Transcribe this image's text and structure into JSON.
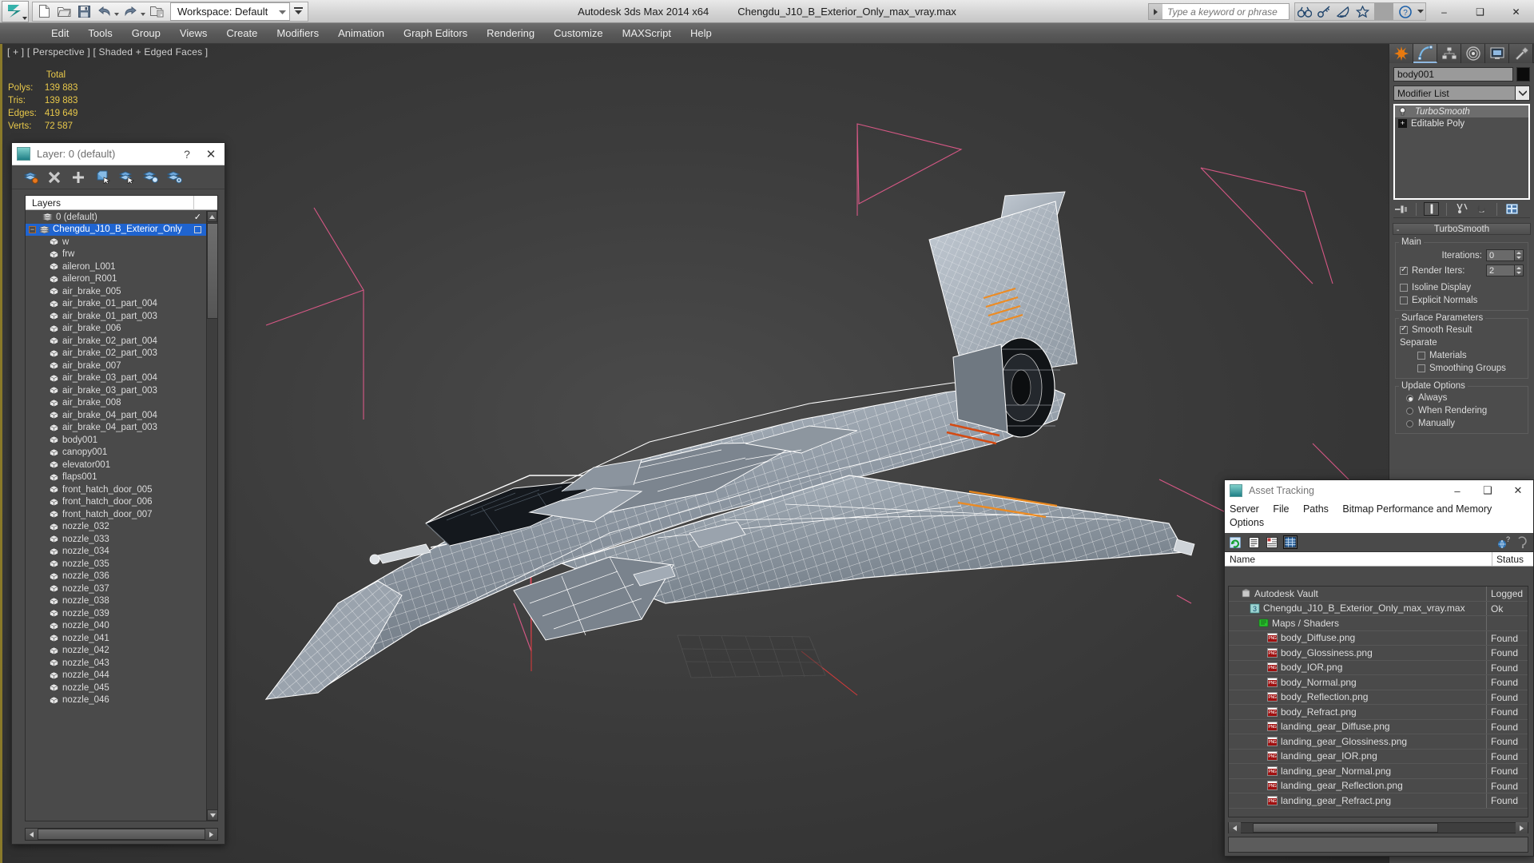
{
  "titlebar": {
    "app_title": "Autodesk 3ds Max  2014 x64",
    "file_title": "Chengdu_J10_B_Exterior_Only_max_vray.max",
    "workspace_label": "Workspace: Default",
    "search_placeholder": "Type a keyword or phrase",
    "quick_access": [
      "new-file-icon",
      "open-file-icon",
      "save-file-icon",
      "undo-icon",
      "redo-icon",
      "set-project-folder-icon"
    ],
    "infocenter_icons": [
      "binoculars-icon",
      "key-icon",
      "satellite-dish-icon",
      "star-icon",
      "help-icon"
    ],
    "window_buttons": {
      "minimize": "–",
      "maximize": "❑",
      "close": "✕"
    }
  },
  "menubar": {
    "items": [
      "Edit",
      "Tools",
      "Group",
      "Views",
      "Create",
      "Modifiers",
      "Animation",
      "Graph Editors",
      "Rendering",
      "Customize",
      "MAXScript",
      "Help"
    ]
  },
  "viewport": {
    "label": "[ + ] [ Perspective ] [ Shaded + Edged Faces ]",
    "stats": {
      "header": "Total",
      "rows": [
        {
          "label": "Polys:",
          "value": "139 883"
        },
        {
          "label": "Tris:",
          "value": "139 883"
        },
        {
          "label": "Edges:",
          "value": "419 649"
        },
        {
          "label": "Verts:",
          "value": "72 587"
        }
      ]
    },
    "colors": {
      "stats_text": "#e8c84a",
      "gizmo_pink": "#e05a8a",
      "background": "#3c3c3c"
    }
  },
  "layer_dialog": {
    "title": "Layer: 0 (default)",
    "help_glyph": "?",
    "close_glyph": "✕",
    "toolbar_icons": [
      "create-new-layer-icon",
      "delete-layer-icon",
      "add-selection-to-layer-icon",
      "select-objects-in-layer-icon",
      "select-highlighted-objects-icon",
      "highlight-selected-objects-icon",
      "layer-properties-icon"
    ],
    "column_header": "Layers",
    "rows": [
      {
        "label": "0 (default)",
        "indent": 1,
        "type": "layer",
        "selected": false,
        "check": "✓"
      },
      {
        "label": "Chengdu_J10_B_Exterior_Only",
        "indent": 0,
        "type": "layer",
        "selected": true,
        "expander": "−",
        "square": true
      },
      {
        "label": "w",
        "indent": 2,
        "type": "object"
      },
      {
        "label": "frw",
        "indent": 2,
        "type": "object"
      },
      {
        "label": "aileron_L001",
        "indent": 2,
        "type": "object"
      },
      {
        "label": "aileron_R001",
        "indent": 2,
        "type": "object"
      },
      {
        "label": "air_brake_005",
        "indent": 2,
        "type": "object"
      },
      {
        "label": "air_brake_01_part_004",
        "indent": 2,
        "type": "object"
      },
      {
        "label": "air_brake_01_part_003",
        "indent": 2,
        "type": "object"
      },
      {
        "label": "air_brake_006",
        "indent": 2,
        "type": "object"
      },
      {
        "label": "air_brake_02_part_004",
        "indent": 2,
        "type": "object"
      },
      {
        "label": "air_brake_02_part_003",
        "indent": 2,
        "type": "object"
      },
      {
        "label": "air_brake_007",
        "indent": 2,
        "type": "object"
      },
      {
        "label": "air_brake_03_part_004",
        "indent": 2,
        "type": "object"
      },
      {
        "label": "air_brake_03_part_003",
        "indent": 2,
        "type": "object"
      },
      {
        "label": "air_brake_008",
        "indent": 2,
        "type": "object"
      },
      {
        "label": "air_brake_04_part_004",
        "indent": 2,
        "type": "object"
      },
      {
        "label": "air_brake_04_part_003",
        "indent": 2,
        "type": "object"
      },
      {
        "label": "body001",
        "indent": 2,
        "type": "object"
      },
      {
        "label": "canopy001",
        "indent": 2,
        "type": "object"
      },
      {
        "label": "elevator001",
        "indent": 2,
        "type": "object"
      },
      {
        "label": "flaps001",
        "indent": 2,
        "type": "object"
      },
      {
        "label": "front_hatch_door_005",
        "indent": 2,
        "type": "object"
      },
      {
        "label": "front_hatch_door_006",
        "indent": 2,
        "type": "object"
      },
      {
        "label": "front_hatch_door_007",
        "indent": 2,
        "type": "object"
      },
      {
        "label": "nozzle_032",
        "indent": 2,
        "type": "object"
      },
      {
        "label": "nozzle_033",
        "indent": 2,
        "type": "object"
      },
      {
        "label": "nozzle_034",
        "indent": 2,
        "type": "object"
      },
      {
        "label": "nozzle_035",
        "indent": 2,
        "type": "object"
      },
      {
        "label": "nozzle_036",
        "indent": 2,
        "type": "object"
      },
      {
        "label": "nozzle_037",
        "indent": 2,
        "type": "object"
      },
      {
        "label": "nozzle_038",
        "indent": 2,
        "type": "object"
      },
      {
        "label": "nozzle_039",
        "indent": 2,
        "type": "object"
      },
      {
        "label": "nozzle_040",
        "indent": 2,
        "type": "object"
      },
      {
        "label": "nozzle_041",
        "indent": 2,
        "type": "object"
      },
      {
        "label": "nozzle_042",
        "indent": 2,
        "type": "object"
      },
      {
        "label": "nozzle_043",
        "indent": 2,
        "type": "object"
      },
      {
        "label": "nozzle_044",
        "indent": 2,
        "type": "object"
      },
      {
        "label": "nozzle_045",
        "indent": 2,
        "type": "object"
      },
      {
        "label": "nozzle_046",
        "indent": 2,
        "type": "object"
      }
    ]
  },
  "asset_tracking": {
    "title": "Asset Tracking",
    "window_buttons": {
      "minimize": "–",
      "maximize": "❑",
      "close": "✕"
    },
    "menu": [
      "Server",
      "File",
      "Paths",
      "Bitmap Performance and Memory",
      "Options"
    ],
    "toolbar_icons": [
      "refresh-icon",
      "list-view-icon",
      "details-view-icon",
      "grid-view-icon",
      "help-web-icon",
      "help-icon"
    ],
    "columns": {
      "name": "Name",
      "status": "Status"
    },
    "rows": [
      {
        "name": "Autodesk Vault",
        "status": "Logged",
        "indent": 1,
        "icon": "vault-icon"
      },
      {
        "name": "Chengdu_J10_B_Exterior_Only_max_vray.max",
        "status": "Ok",
        "indent": 2,
        "icon": "max-file-icon"
      },
      {
        "name": "Maps / Shaders",
        "status": "",
        "indent": 3,
        "icon": "maps-shaders-icon"
      },
      {
        "name": "body_Diffuse.png",
        "status": "Found",
        "indent": 4,
        "icon": "png-icon"
      },
      {
        "name": "body_Glossiness.png",
        "status": "Found",
        "indent": 4,
        "icon": "png-icon"
      },
      {
        "name": "body_IOR.png",
        "status": "Found",
        "indent": 4,
        "icon": "png-icon"
      },
      {
        "name": "body_Normal.png",
        "status": "Found",
        "indent": 4,
        "icon": "png-icon"
      },
      {
        "name": "body_Reflection.png",
        "status": "Found",
        "indent": 4,
        "icon": "png-icon"
      },
      {
        "name": "body_Refract.png",
        "status": "Found",
        "indent": 4,
        "icon": "png-icon"
      },
      {
        "name": "landing_gear_Diffuse.png",
        "status": "Found",
        "indent": 4,
        "icon": "png-icon"
      },
      {
        "name": "landing_gear_Glossiness.png",
        "status": "Found",
        "indent": 4,
        "icon": "png-icon"
      },
      {
        "name": "landing_gear_IOR.png",
        "status": "Found",
        "indent": 4,
        "icon": "png-icon"
      },
      {
        "name": "landing_gear_Normal.png",
        "status": "Found",
        "indent": 4,
        "icon": "png-icon"
      },
      {
        "name": "landing_gear_Reflection.png",
        "status": "Found",
        "indent": 4,
        "icon": "png-icon"
      },
      {
        "name": "landing_gear_Refract.png",
        "status": "Found",
        "indent": 4,
        "icon": "png-icon"
      }
    ]
  },
  "command_panel": {
    "tabs": [
      "create-tab",
      "modify-tab",
      "hierarchy-tab",
      "motion-tab",
      "display-tab",
      "utilities-tab"
    ],
    "active_tab_index": 1,
    "object_name": "body001",
    "modifier_list_label": "Modifier List",
    "stack": [
      {
        "label": "TurboSmooth",
        "italic": true
      },
      {
        "label": "Editable Poly",
        "italic": false,
        "expandable": "+"
      }
    ],
    "stack_tools": [
      "pin-stack-icon",
      "show-end-result-icon",
      "make-unique-icon",
      "remove-modifier-icon",
      "configure-modifier-sets-icon"
    ],
    "rollout": {
      "title": "TurboSmooth",
      "minus": "-",
      "groups": [
        {
          "title": "Main",
          "fields": [
            {
              "type": "spinner",
              "label": "Iterations:",
              "value": "0"
            },
            {
              "type": "spinner",
              "label": "Render Iters:",
              "value": "2",
              "checkbox": true,
              "checked": true
            },
            {
              "type": "checkbox",
              "label": "Isoline Display",
              "checked": false
            },
            {
              "type": "checkbox",
              "label": "Explicit Normals",
              "checked": false
            }
          ]
        },
        {
          "title": "Surface Parameters",
          "fields": [
            {
              "type": "checkbox",
              "label": "Smooth Result",
              "checked": true
            },
            {
              "type": "text",
              "label": "Separate"
            },
            {
              "type": "checkbox",
              "label": "Materials",
              "checked": false,
              "indent": true
            },
            {
              "type": "checkbox",
              "label": "Smoothing Groups",
              "checked": false,
              "indent": true
            }
          ]
        },
        {
          "title": "Update Options",
          "fields": [
            {
              "type": "radio",
              "label": "Always",
              "checked": true
            },
            {
              "type": "radio",
              "label": "When Rendering",
              "checked": false
            },
            {
              "type": "radio",
              "label": "Manually",
              "checked": false
            }
          ]
        }
      ]
    }
  }
}
